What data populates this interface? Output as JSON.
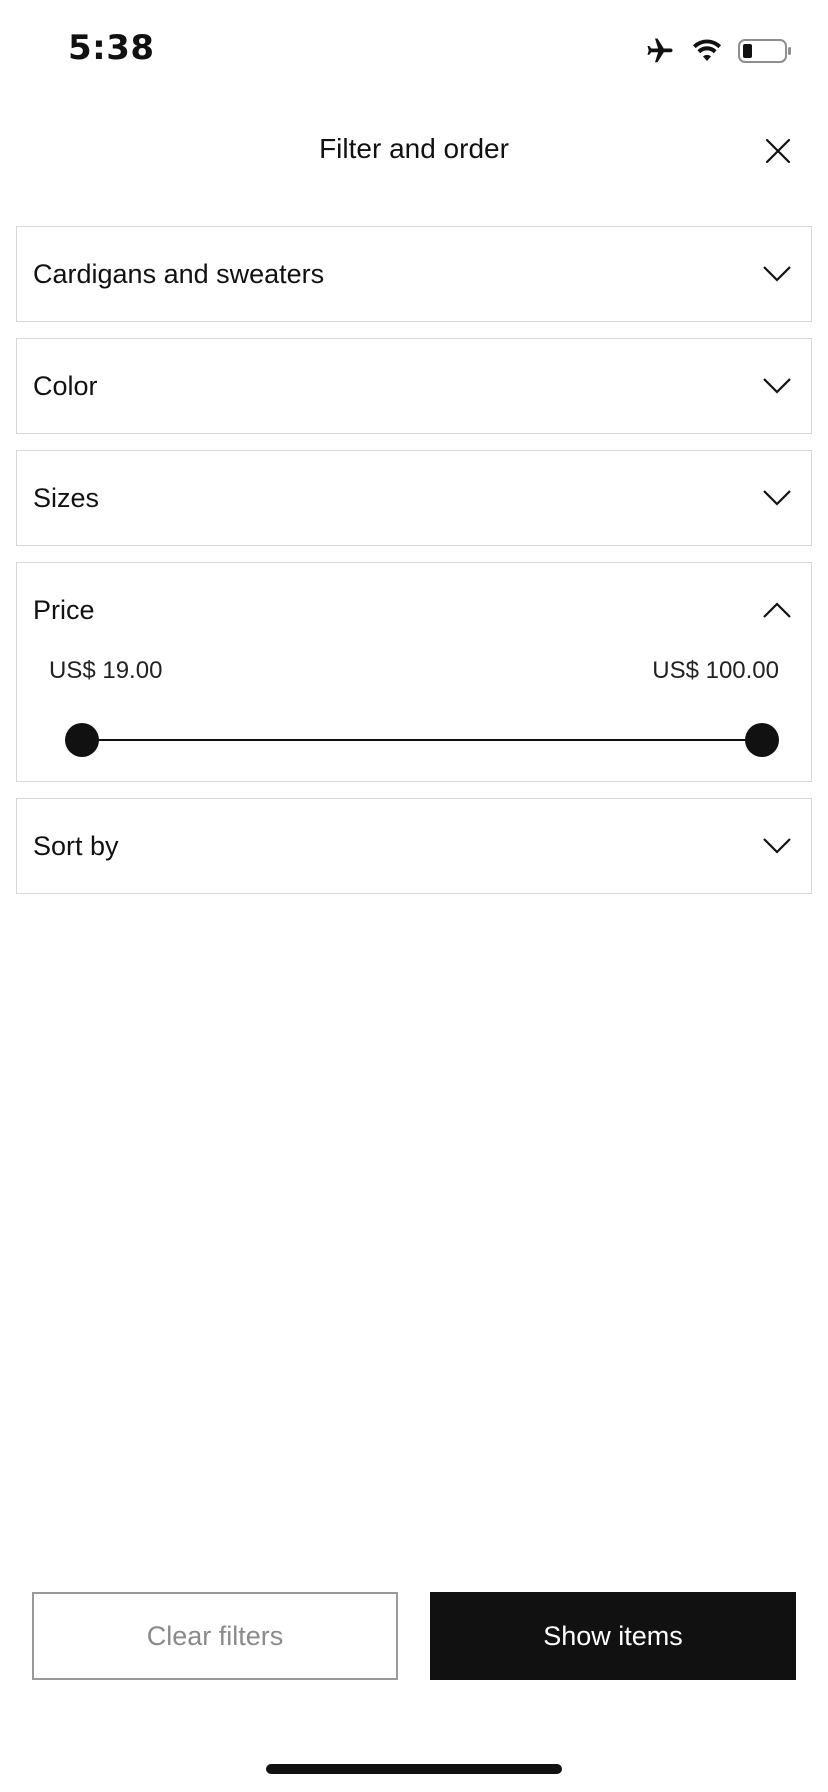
{
  "status_bar": {
    "time": "5:38",
    "icons": [
      "airplane-icon",
      "wifi-icon",
      "battery-icon"
    ]
  },
  "header": {
    "title": "Filter and order",
    "close_icon": "close-icon"
  },
  "sections": {
    "category": {
      "label": "Cardigans and sweaters",
      "expanded": false
    },
    "color": {
      "label": "Color",
      "expanded": false
    },
    "sizes": {
      "label": "Sizes",
      "expanded": false
    },
    "price": {
      "label": "Price",
      "expanded": true,
      "min_value": "US$ 19.00",
      "max_value": "US$ 100.00"
    },
    "sort": {
      "label": "Sort by",
      "expanded": false
    }
  },
  "actions": {
    "clear_label": "Clear filters",
    "show_label": "Show items"
  },
  "colors": {
    "primary": "#111111",
    "border": "#d6d6d6",
    "muted_text": "#8a8a8a"
  }
}
